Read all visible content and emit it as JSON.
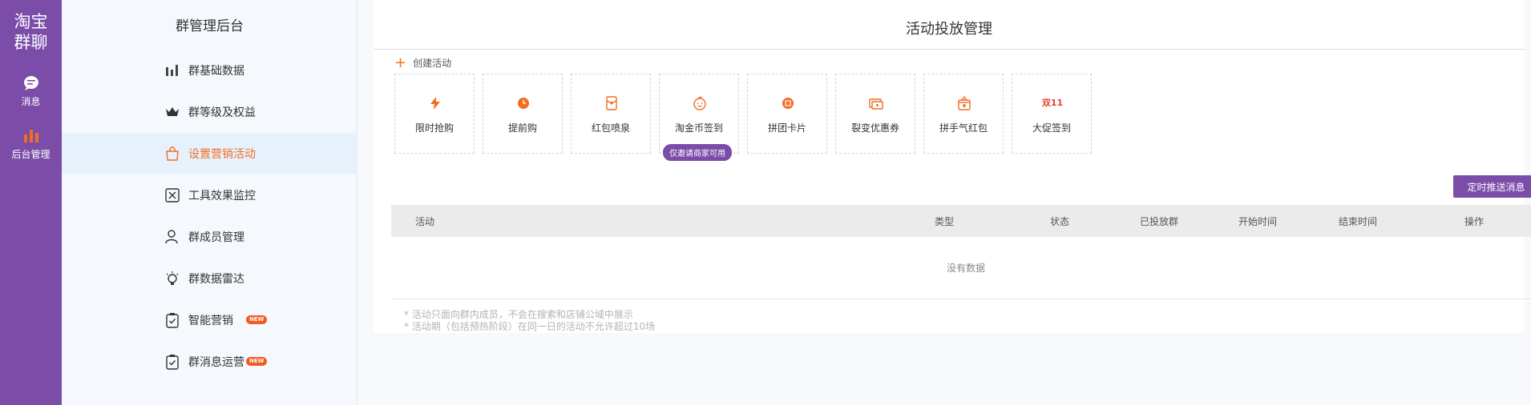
{
  "rail": {
    "logo_line1": "淘宝",
    "logo_line2": "群聊",
    "items": [
      {
        "label": "消息",
        "icon": "chat-bubble-icon"
      },
      {
        "label": "后台管理",
        "icon": "bar-chart-icon"
      }
    ]
  },
  "sidebar": {
    "title": "群管理后台",
    "items": [
      {
        "label": "群基础数据",
        "icon": "bar-chart-icon"
      },
      {
        "label": "群等级及权益",
        "icon": "crown-icon"
      },
      {
        "label": "设置营销活动",
        "icon": "shopping-bag-icon",
        "active": true
      },
      {
        "label": "工具效果监控",
        "icon": "monitor-icon"
      },
      {
        "label": "群成员管理",
        "icon": "user-icon"
      },
      {
        "label": "群数据雷达",
        "icon": "lightbulb-icon"
      },
      {
        "label": "智能营销",
        "icon": "clipboard-check-icon",
        "badge": "NEW"
      },
      {
        "label": "群消息运营",
        "icon": "clipboard-check-icon",
        "badge": "NEW"
      }
    ]
  },
  "main": {
    "title": "活动投放管理",
    "create_label": "创建活动",
    "tools": [
      {
        "label": "限时抢购",
        "icon": "lightning-icon"
      },
      {
        "label": "提前购",
        "icon": "clock-icon"
      },
      {
        "label": "红包喷泉",
        "icon": "red-envelope-icon"
      },
      {
        "label": "淘金币签到",
        "icon": "coin-face-icon",
        "tag": "仅邀请商家可用"
      },
      {
        "label": "拼团卡片",
        "icon": "group-badge-icon"
      },
      {
        "label": "裂变优惠券",
        "icon": "coupon-icon"
      },
      {
        "label": "拼手气红包",
        "icon": "gift-bag-icon"
      },
      {
        "label": "大促签到",
        "icon": "double-eleven-icon",
        "glyph": "双11"
      }
    ],
    "push_button": "定时推送消息",
    "table": {
      "headers": [
        "活动",
        "类型",
        "状态",
        "已投放群",
        "开始时间",
        "结束时间",
        "操作"
      ],
      "empty_text": "没有数据"
    },
    "notes": [
      "* 活动只面向群内成员，不会在搜索和店铺公域中展示",
      "* 活动期（包括预热阶段）在同一日的活动不允许超过10场"
    ]
  },
  "colors": {
    "brand_purple": "#7b4ca8",
    "accent_orange": "#f26d21",
    "active_bg": "#e6f1fb"
  }
}
